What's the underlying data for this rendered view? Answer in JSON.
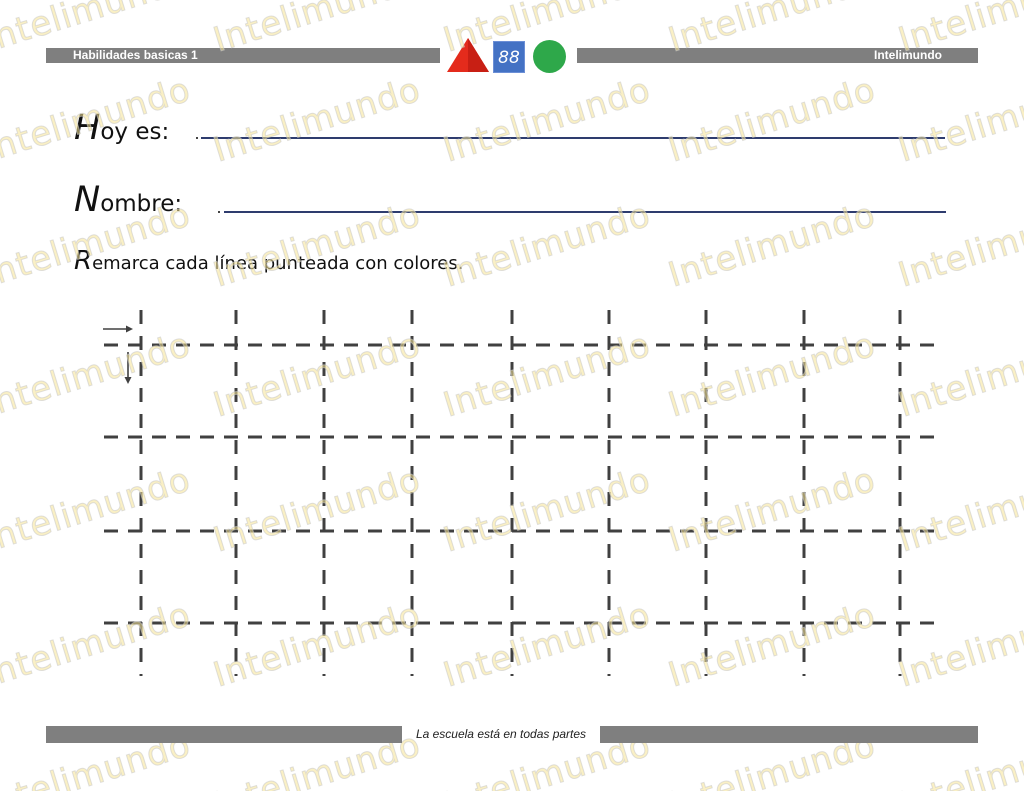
{
  "header": {
    "left_text": "Habilidades basicas 1",
    "right_text": "Intelimundo",
    "logo": {
      "triangle_color": "#e42b1c",
      "square_color": "#4472c4",
      "square_text": "88",
      "circle_color": "#2ea84a"
    }
  },
  "form": {
    "date_cap": "H",
    "date_rest": "oy es:",
    "name_cap": "N",
    "name_rest": "ombre:"
  },
  "instruction": {
    "cap": "R",
    "rest": "emarca cada línea punteada con colores."
  },
  "watermark": {
    "text": "Intelimundo"
  },
  "footer": {
    "text": "La escuela está en todas partes"
  },
  "icons": [
    "triangle-shape",
    "square-shape",
    "circle-shape",
    "arrow-right-icon",
    "arrow-down-icon"
  ],
  "colors": {
    "bar_gray": "#7f7f7f",
    "dash_color": "#404040",
    "line_navy": "#2e3c6e"
  }
}
